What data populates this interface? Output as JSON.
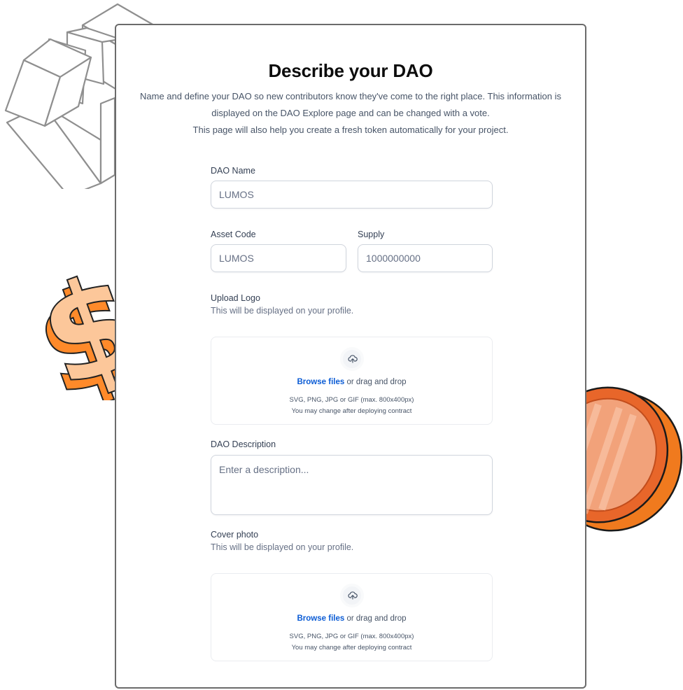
{
  "header": {
    "title": "Describe your DAO",
    "description_lines": [
      "Name and define your DAO so new contributors know they've come to the right place. This information is",
      "displayed on the DAO Explore page and can be changed with a vote.",
      "This page will also help you create a fresh token automatically for your project."
    ]
  },
  "form": {
    "dao_name": {
      "label": "DAO Name",
      "placeholder": "LUMOS",
      "value": ""
    },
    "asset_code": {
      "label": "Asset Code",
      "placeholder": "LUMOS",
      "value": ""
    },
    "supply": {
      "label": "Supply",
      "placeholder": "1000000000",
      "value": ""
    },
    "upload_logo": {
      "label": "Upload Logo",
      "hint": "This will be displayed on your profile.",
      "browse_label": "Browse files",
      "drag_text": "or drag and drop",
      "formats": "SVG, PNG, JPG or GIF (max. 800x400px)",
      "note": "You may change after deploying contract",
      "icon": "upload-cloud-icon"
    },
    "description": {
      "label": "DAO Description",
      "placeholder": "Enter a description..."
    },
    "cover_photo": {
      "label": "Cover photo",
      "hint": "This will be displayed on your profile.",
      "browse_label": "Browse files",
      "drag_text": "or drag and drop",
      "formats": "SVG, PNG, JPG or GIF (max. 800x400px)",
      "note": "You may change after deploying contract",
      "icon": "upload-cloud-icon"
    }
  },
  "decorations": [
    "cubes-illustration",
    "dollar-sign-illustration",
    "coin-illustration"
  ],
  "colors": {
    "accent_link": "#0b5cd5",
    "coin_orange": "#e8662a",
    "dollar_peach": "#fcc79a",
    "dollar_orange": "#ff8a2a"
  }
}
